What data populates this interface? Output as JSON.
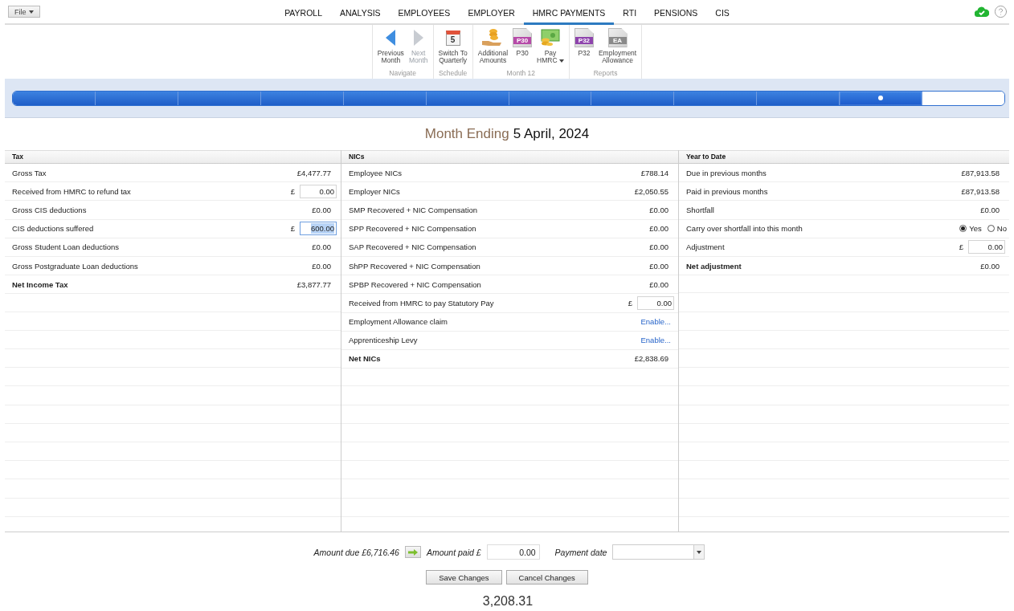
{
  "file_menu": {
    "label": "File",
    "dropdown": true
  },
  "nav_tabs": [
    {
      "label": "PAYROLL",
      "selected": false
    },
    {
      "label": "ANALYSIS",
      "selected": false
    },
    {
      "label": "EMPLOYEES",
      "selected": false
    },
    {
      "label": "EMPLOYER",
      "selected": false
    },
    {
      "label": "HMRC PAYMENTS",
      "selected": true
    },
    {
      "label": "RTI",
      "selected": false
    },
    {
      "label": "PENSIONS",
      "selected": false
    },
    {
      "label": "CIS",
      "selected": false
    }
  ],
  "sync_status": {
    "synced": true
  },
  "ribbon": [
    {
      "label": "Navigate",
      "buttons": [
        {
          "kind": "arrow-left",
          "lines": [
            "Previous",
            "Month"
          ],
          "disabled": false,
          "dropdown": false
        },
        {
          "kind": "arrow-right",
          "lines": [
            "Next",
            "Month"
          ],
          "disabled": true,
          "dropdown": false
        }
      ]
    },
    {
      "label": "Schedule",
      "buttons": [
        {
          "kind": "calendar",
          "day": "5",
          "lines": [
            "Switch To",
            "Quarterly"
          ],
          "disabled": false,
          "dropdown": false
        }
      ]
    },
    {
      "label": "Month 12",
      "buttons": [
        {
          "kind": "coins",
          "lines": [
            "Additional",
            "Amounts"
          ],
          "disabled": false,
          "dropdown": false
        },
        {
          "kind": "document",
          "badge": "P30",
          "color": "#b64aa8",
          "lines": [
            "P30"
          ],
          "disabled": false,
          "dropdown": false
        },
        {
          "kind": "banknote",
          "lines": [
            "Pay",
            "HMRC"
          ],
          "disabled": false,
          "dropdown": true
        }
      ]
    },
    {
      "label": "Reports",
      "buttons": [
        {
          "kind": "document",
          "badge": "P32",
          "color": "#8e44ad",
          "lines": [
            "P32"
          ],
          "disabled": false,
          "dropdown": false
        },
        {
          "kind": "document",
          "badge": "EA",
          "color": "#8a8a8a",
          "lines": [
            "Employment",
            "Allowance"
          ],
          "disabled": false,
          "dropdown": false
        }
      ]
    }
  ],
  "months": [
    {
      "completed": true,
      "current": false
    },
    {
      "completed": true,
      "current": false
    },
    {
      "completed": true,
      "current": false
    },
    {
      "completed": true,
      "current": false
    },
    {
      "completed": true,
      "current": false
    },
    {
      "completed": true,
      "current": false
    },
    {
      "completed": true,
      "current": false
    },
    {
      "completed": true,
      "current": false
    },
    {
      "completed": true,
      "current": false
    },
    {
      "completed": true,
      "current": false
    },
    {
      "completed": true,
      "current": true
    },
    {
      "completed": false,
      "current": false
    }
  ],
  "title": {
    "prefix": "Month Ending",
    "date": "5 April, 2024"
  },
  "columns": [
    {
      "heading": "Tax",
      "rows": [
        {
          "label": "Gross Tax",
          "kind": "amount",
          "value": "£4,477.77",
          "bold": false
        },
        {
          "label": "Received from HMRC to refund tax",
          "kind": "input",
          "currency": "£",
          "value": "0.00",
          "focused": false,
          "bold": false
        },
        {
          "label": "Gross CIS deductions",
          "kind": "amount",
          "value": "£0.00",
          "bold": false
        },
        {
          "label": "CIS deductions suffered",
          "kind": "input",
          "currency": "£",
          "value": "600.00",
          "focused": true,
          "bold": false
        },
        {
          "label": "Gross Student Loan deductions",
          "kind": "amount",
          "value": "£0.00",
          "bold": false
        },
        {
          "label": "Gross Postgraduate Loan deductions",
          "kind": "amount",
          "value": "£0.00",
          "bold": false
        },
        {
          "label": "Net Income Tax",
          "kind": "amount",
          "value": "£3,877.77",
          "bold": true
        }
      ]
    },
    {
      "heading": "NICs",
      "rows": [
        {
          "label": "Employee NICs",
          "kind": "amount",
          "value": "£788.14",
          "bold": false
        },
        {
          "label": "Employer NICs",
          "kind": "amount",
          "value": "£2,050.55",
          "bold": false
        },
        {
          "label": "SMP Recovered + NIC Compensation",
          "kind": "amount",
          "value": "£0.00",
          "bold": false
        },
        {
          "label": "SPP Recovered + NIC Compensation",
          "kind": "amount",
          "value": "£0.00",
          "bold": false
        },
        {
          "label": "SAP Recovered + NIC Compensation",
          "kind": "amount",
          "value": "£0.00",
          "bold": false
        },
        {
          "label": "ShPP Recovered + NIC Compensation",
          "kind": "amount",
          "value": "£0.00",
          "bold": false
        },
        {
          "label": "SPBP Recovered + NIC Compensation",
          "kind": "amount",
          "value": "£0.00",
          "bold": false
        },
        {
          "label": "Received from HMRC to pay Statutory Pay",
          "kind": "input",
          "currency": "£",
          "value": "0.00",
          "focused": false,
          "bold": false
        },
        {
          "label": "Employment Allowance claim",
          "kind": "link",
          "value": "Enable...",
          "bold": false
        },
        {
          "label": "Apprenticeship Levy",
          "kind": "link",
          "value": "Enable...",
          "bold": false
        },
        {
          "label": "Net NICs",
          "kind": "amount",
          "value": "£2,838.69",
          "bold": true
        }
      ]
    },
    {
      "heading": "Year to Date",
      "rows": [
        {
          "label": "Due in previous months",
          "kind": "amount",
          "value": "£87,913.58",
          "bold": false
        },
        {
          "label": "Paid in previous months",
          "kind": "amount",
          "value": "£87,913.58",
          "bold": false
        },
        {
          "label": "Shortfall",
          "kind": "amount",
          "value": "£0.00",
          "bold": false
        },
        {
          "label": "Carry over shortfall into this month",
          "kind": "choice",
          "options": [
            {
              "label": "Yes",
              "selected": true
            },
            {
              "label": "No",
              "selected": false
            }
          ],
          "bold": false
        },
        {
          "label": "Adjustment",
          "kind": "input",
          "currency": "£",
          "value": "0.00",
          "focused": false,
          "bold": false
        },
        {
          "label": "Net adjustment",
          "kind": "amount",
          "value": "£0.00",
          "bold": true
        }
      ]
    }
  ],
  "payment": {
    "amount_due": "Amount due £6,716.46",
    "amount_paid_label": "Amount paid £",
    "amount_paid": "0.00",
    "payment_date_label": "Payment date"
  },
  "buttons": [
    "Save Changes",
    "Cancel Changes"
  ],
  "total": "3,208.31"
}
